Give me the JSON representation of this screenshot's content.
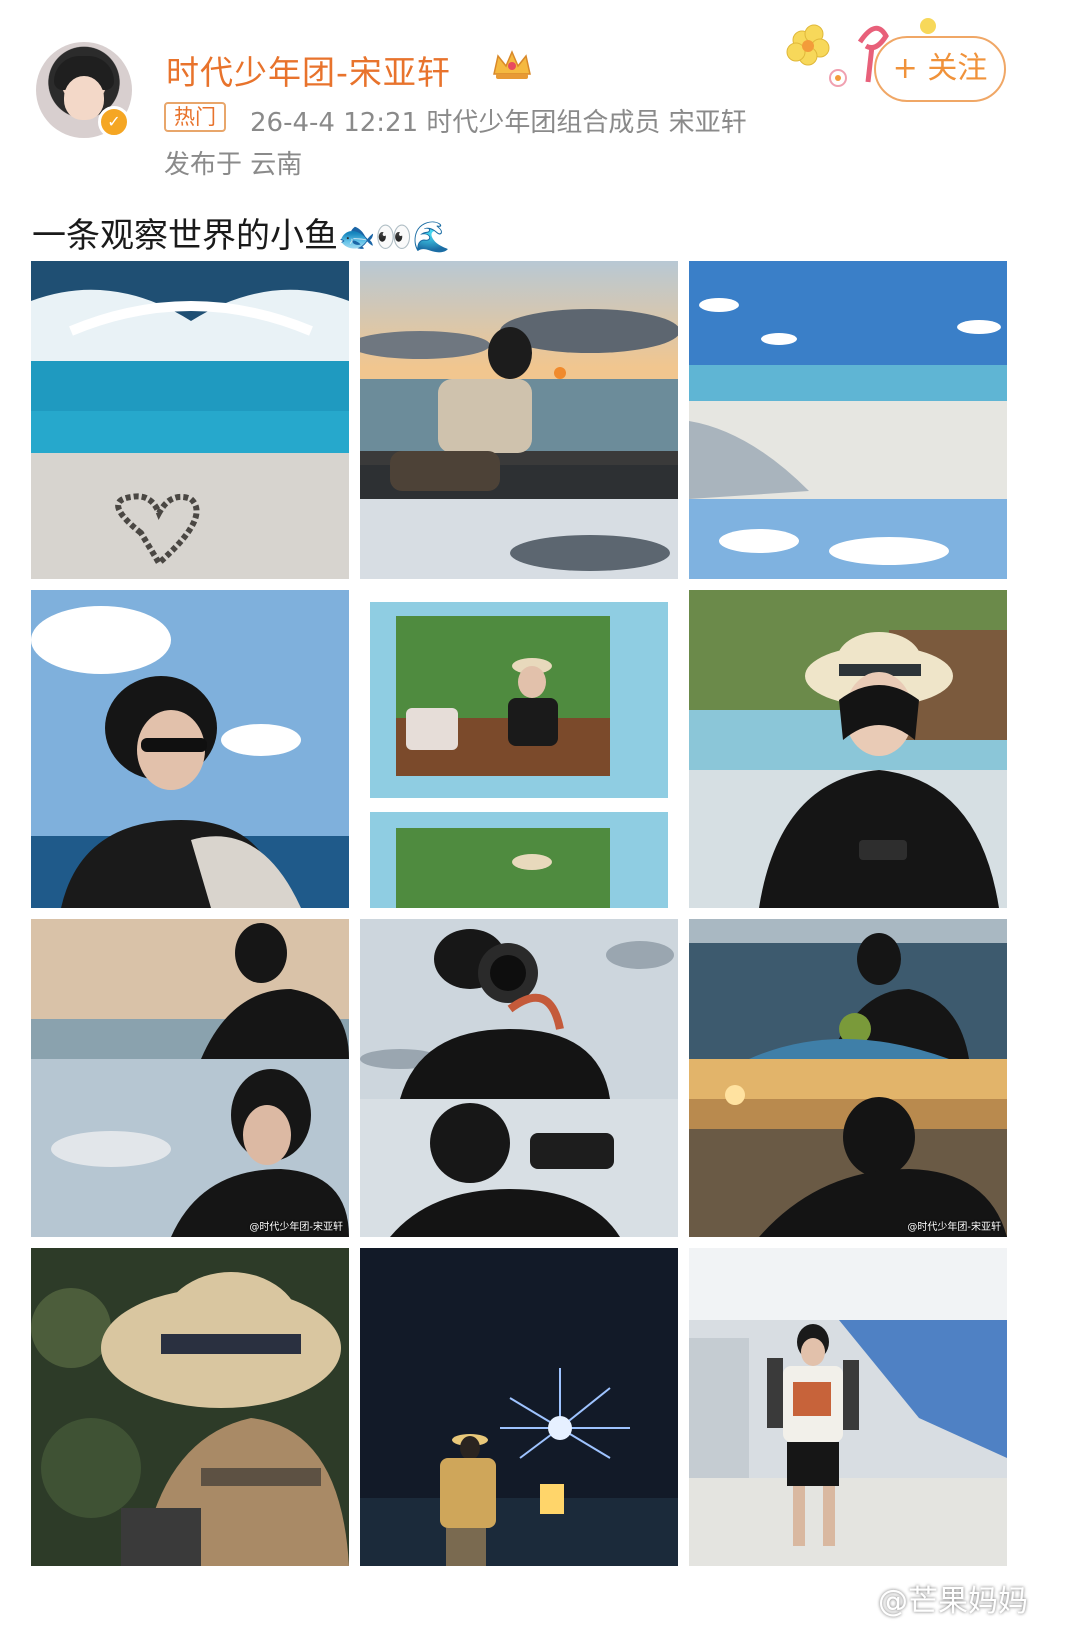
{
  "post": {
    "username": "时代少年团-宋亚轩",
    "hot_tag": "热门",
    "meta": "26-4-4 12:21  时代少年团组合成员 宋亚轩",
    "location": "发布于 云南",
    "follow_label": "+ 关注",
    "text": "一条观察世界的小鱼",
    "text_emojis": "🐟👀🌊"
  },
  "photos": {
    "watermark": "@时代少年团-宋亚轩",
    "items": [
      "wake-and-heart",
      "sunset-railing",
      "beach-sky",
      "sunglasses-sky",
      "instant-photos",
      "straw-hat-boat",
      "dusk-profile",
      "camera-shots",
      "boat-sunset",
      "straw-hat-closeup",
      "fireworks-night",
      "white-room-pose"
    ]
  },
  "footer": {
    "watermark": "@芒果妈妈"
  },
  "colors": {
    "accent_orange": "#e8732c",
    "meta_gray": "#8a8a8a"
  }
}
